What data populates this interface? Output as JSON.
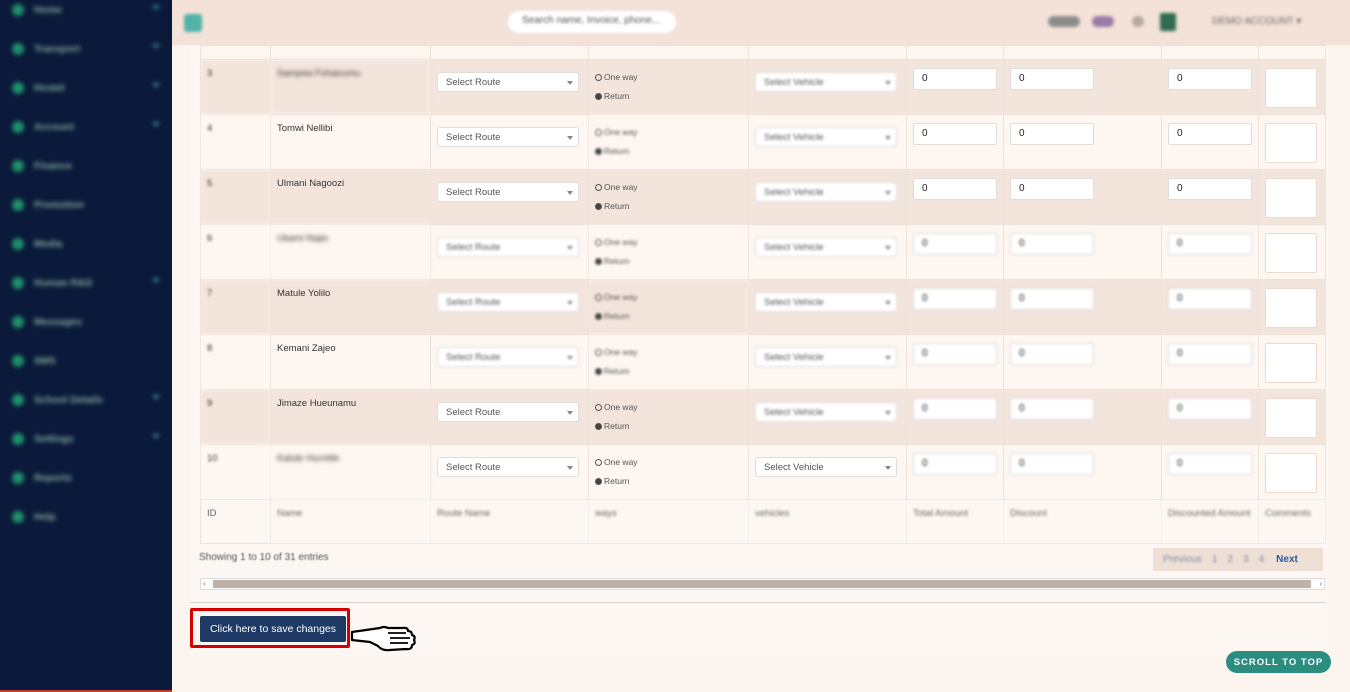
{
  "sidebar": {
    "items": [
      {
        "label": "Home",
        "chevron": true
      },
      {
        "label": "Transport",
        "chevron": true
      },
      {
        "label": "Hostel",
        "chevron": true
      },
      {
        "label": "Account",
        "chevron": true
      },
      {
        "label": "Finance",
        "chevron": false
      },
      {
        "label": "Promotion",
        "chevron": false
      },
      {
        "label": "Media",
        "chevron": false
      },
      {
        "label": "Human R&D",
        "chevron": true
      },
      {
        "label": "Messages",
        "chevron": false
      },
      {
        "label": "SMS",
        "chevron": false
      },
      {
        "label": "School Details",
        "chevron": true
      },
      {
        "label": "Settings",
        "chevron": true
      },
      {
        "label": "Reports",
        "chevron": false
      },
      {
        "label": "Help",
        "chevron": false
      }
    ]
  },
  "topbar": {
    "search_placeholder": "Search name, Invoice, phone...",
    "account_label": "DEMO ACCOUNT",
    "colors": {
      "accent": "#4fb3a6",
      "sidebar": "#0b1a3a"
    }
  },
  "table": {
    "rows": [
      {
        "id": "3",
        "name": "Sampea Fohaoumu",
        "route": "Select Route",
        "trip_options": [
          "One way",
          "Return"
        ],
        "trip_selected": "Return",
        "vehicle": "Select Vehicle",
        "total": "0",
        "discount": "0",
        "discounted": "0"
      },
      {
        "id": "4",
        "name": "Tomwi Nellibi",
        "route": "Select Route",
        "trip_options": [
          "One way",
          "Return"
        ],
        "trip_selected": "Return",
        "vehicle": "Select Vehicle",
        "total": "0",
        "discount": "0",
        "discounted": "0"
      },
      {
        "id": "5",
        "name": "Ulmani Nagoozi",
        "route": "Select Route",
        "trip_options": [
          "One way",
          "Return"
        ],
        "trip_selected": "Return",
        "vehicle": "Select Vehicle",
        "total": "0",
        "discount": "0",
        "discounted": "0"
      },
      {
        "id": "6",
        "name": "Ukami Najio",
        "route": "Select Route",
        "trip_options": [
          "One way",
          "Return"
        ],
        "trip_selected": "Return",
        "vehicle": "Select Vehicle",
        "total": "0",
        "discount": "0",
        "discounted": "0"
      },
      {
        "id": "7",
        "name": "Matule Yolilo",
        "route": "Select Route",
        "trip_options": [
          "One way",
          "Return"
        ],
        "trip_selected": "Return",
        "vehicle": "Select Vehicle",
        "total": "0",
        "discount": "0",
        "discounted": "0"
      },
      {
        "id": "8",
        "name": "Kemani Zajeo",
        "route": "Select Route",
        "trip_options": [
          "One way",
          "Return"
        ],
        "trip_selected": "Return",
        "vehicle": "Select Vehicle",
        "total": "0",
        "discount": "0",
        "discounted": "0"
      },
      {
        "id": "9",
        "name": "Jimaze Hueunamu",
        "route": "Select Route",
        "trip_options": [
          "One way",
          "Return"
        ],
        "trip_selected": "Return",
        "vehicle": "Select Vehicle",
        "total": "0",
        "discount": "0",
        "discounted": "0"
      },
      {
        "id": "10",
        "name": "Kalule Hurrelle",
        "route": "Select Route",
        "trip_options": [
          "One way",
          "Return"
        ],
        "trip_selected": "Return",
        "vehicle": "Select Vehicle",
        "total": "0",
        "discount": "0",
        "discounted": "0"
      }
    ],
    "footer_headers": [
      "ID",
      "Name",
      "Route Name",
      "ways",
      "vehicles",
      "Total Amount",
      "Discount",
      "Discounted Amount",
      "Comments"
    ]
  },
  "pagination": {
    "showing_text": "Showing 1 to 10 of 31 entries",
    "previous": "Previous",
    "pages": [
      "1",
      "2",
      "3",
      "4"
    ],
    "next": "Next"
  },
  "actions": {
    "save_label": "Click here to save changes",
    "scroll_top_label": "SCROLL TO TOP"
  }
}
